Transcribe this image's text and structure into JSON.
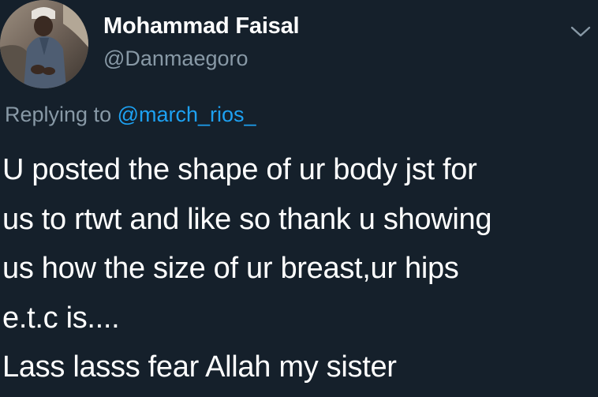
{
  "author": {
    "display_name": "Mohammad Faisal",
    "handle": "@Danmaegoro",
    "avatar_icon": "profile-photo"
  },
  "reply": {
    "prefix": "Replying to",
    "mention": "@march_rios_"
  },
  "tweet": {
    "lines": [
      "U posted the shape of ur body jst for",
      "us to rtwt and like so thank u showing",
      "us how the size of ur breast,ur hips",
      "e.t.c is....",
      "Lass lasss fear Allah my sister"
    ]
  },
  "menu": {
    "icon": "chevron-down-icon"
  },
  "colors": {
    "background": "#15202b",
    "primary_text": "#ffffff",
    "secondary_text": "#8899a6",
    "link": "#1da1f2"
  }
}
